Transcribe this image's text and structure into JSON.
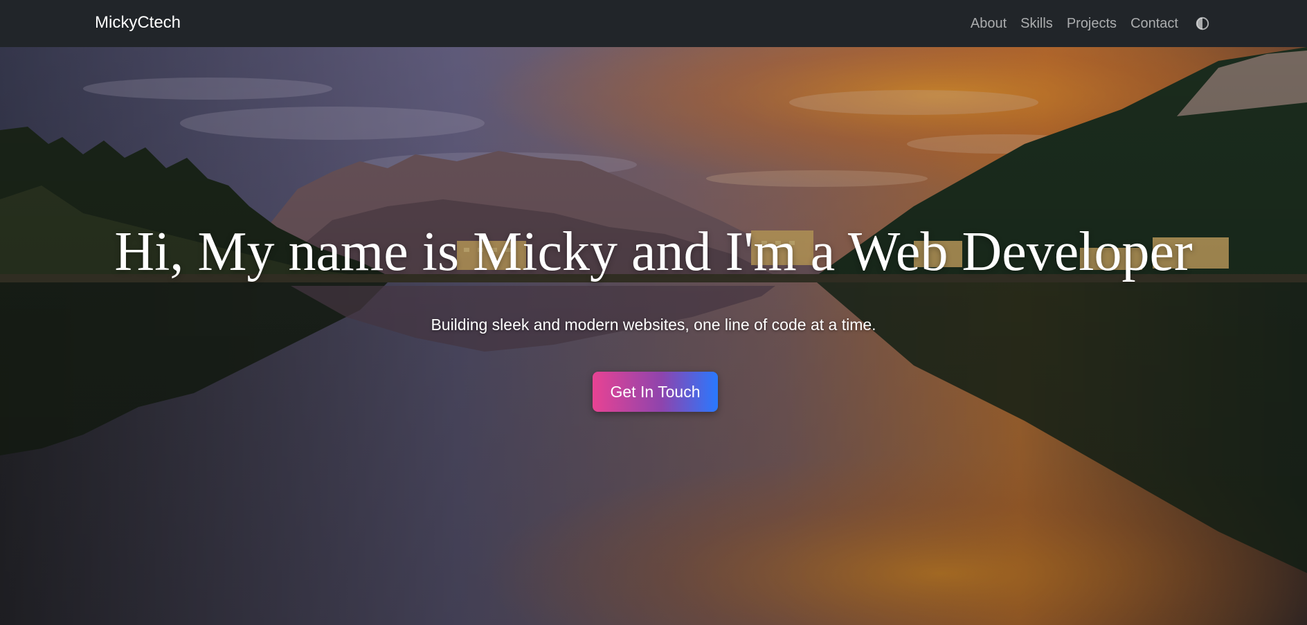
{
  "navbar": {
    "brand": "MickyCtech",
    "links": [
      "About",
      "Skills",
      "Projects",
      "Contact"
    ],
    "theme_toggle_icon": "contrast-half-circle-icon"
  },
  "hero": {
    "background": "mountain-lake-sunset-image",
    "title": "Hi, My name is Micky and I'm a Web Developer",
    "subtitle": "Building sleek and modern websites, one line of code at a time.",
    "cta_label": "Get In Touch"
  },
  "colors": {
    "navbar_bg": "#212529",
    "nav_link": "#a6a8aa",
    "cta_gradient_start": "#e84393",
    "cta_gradient_end": "#2979ff"
  }
}
